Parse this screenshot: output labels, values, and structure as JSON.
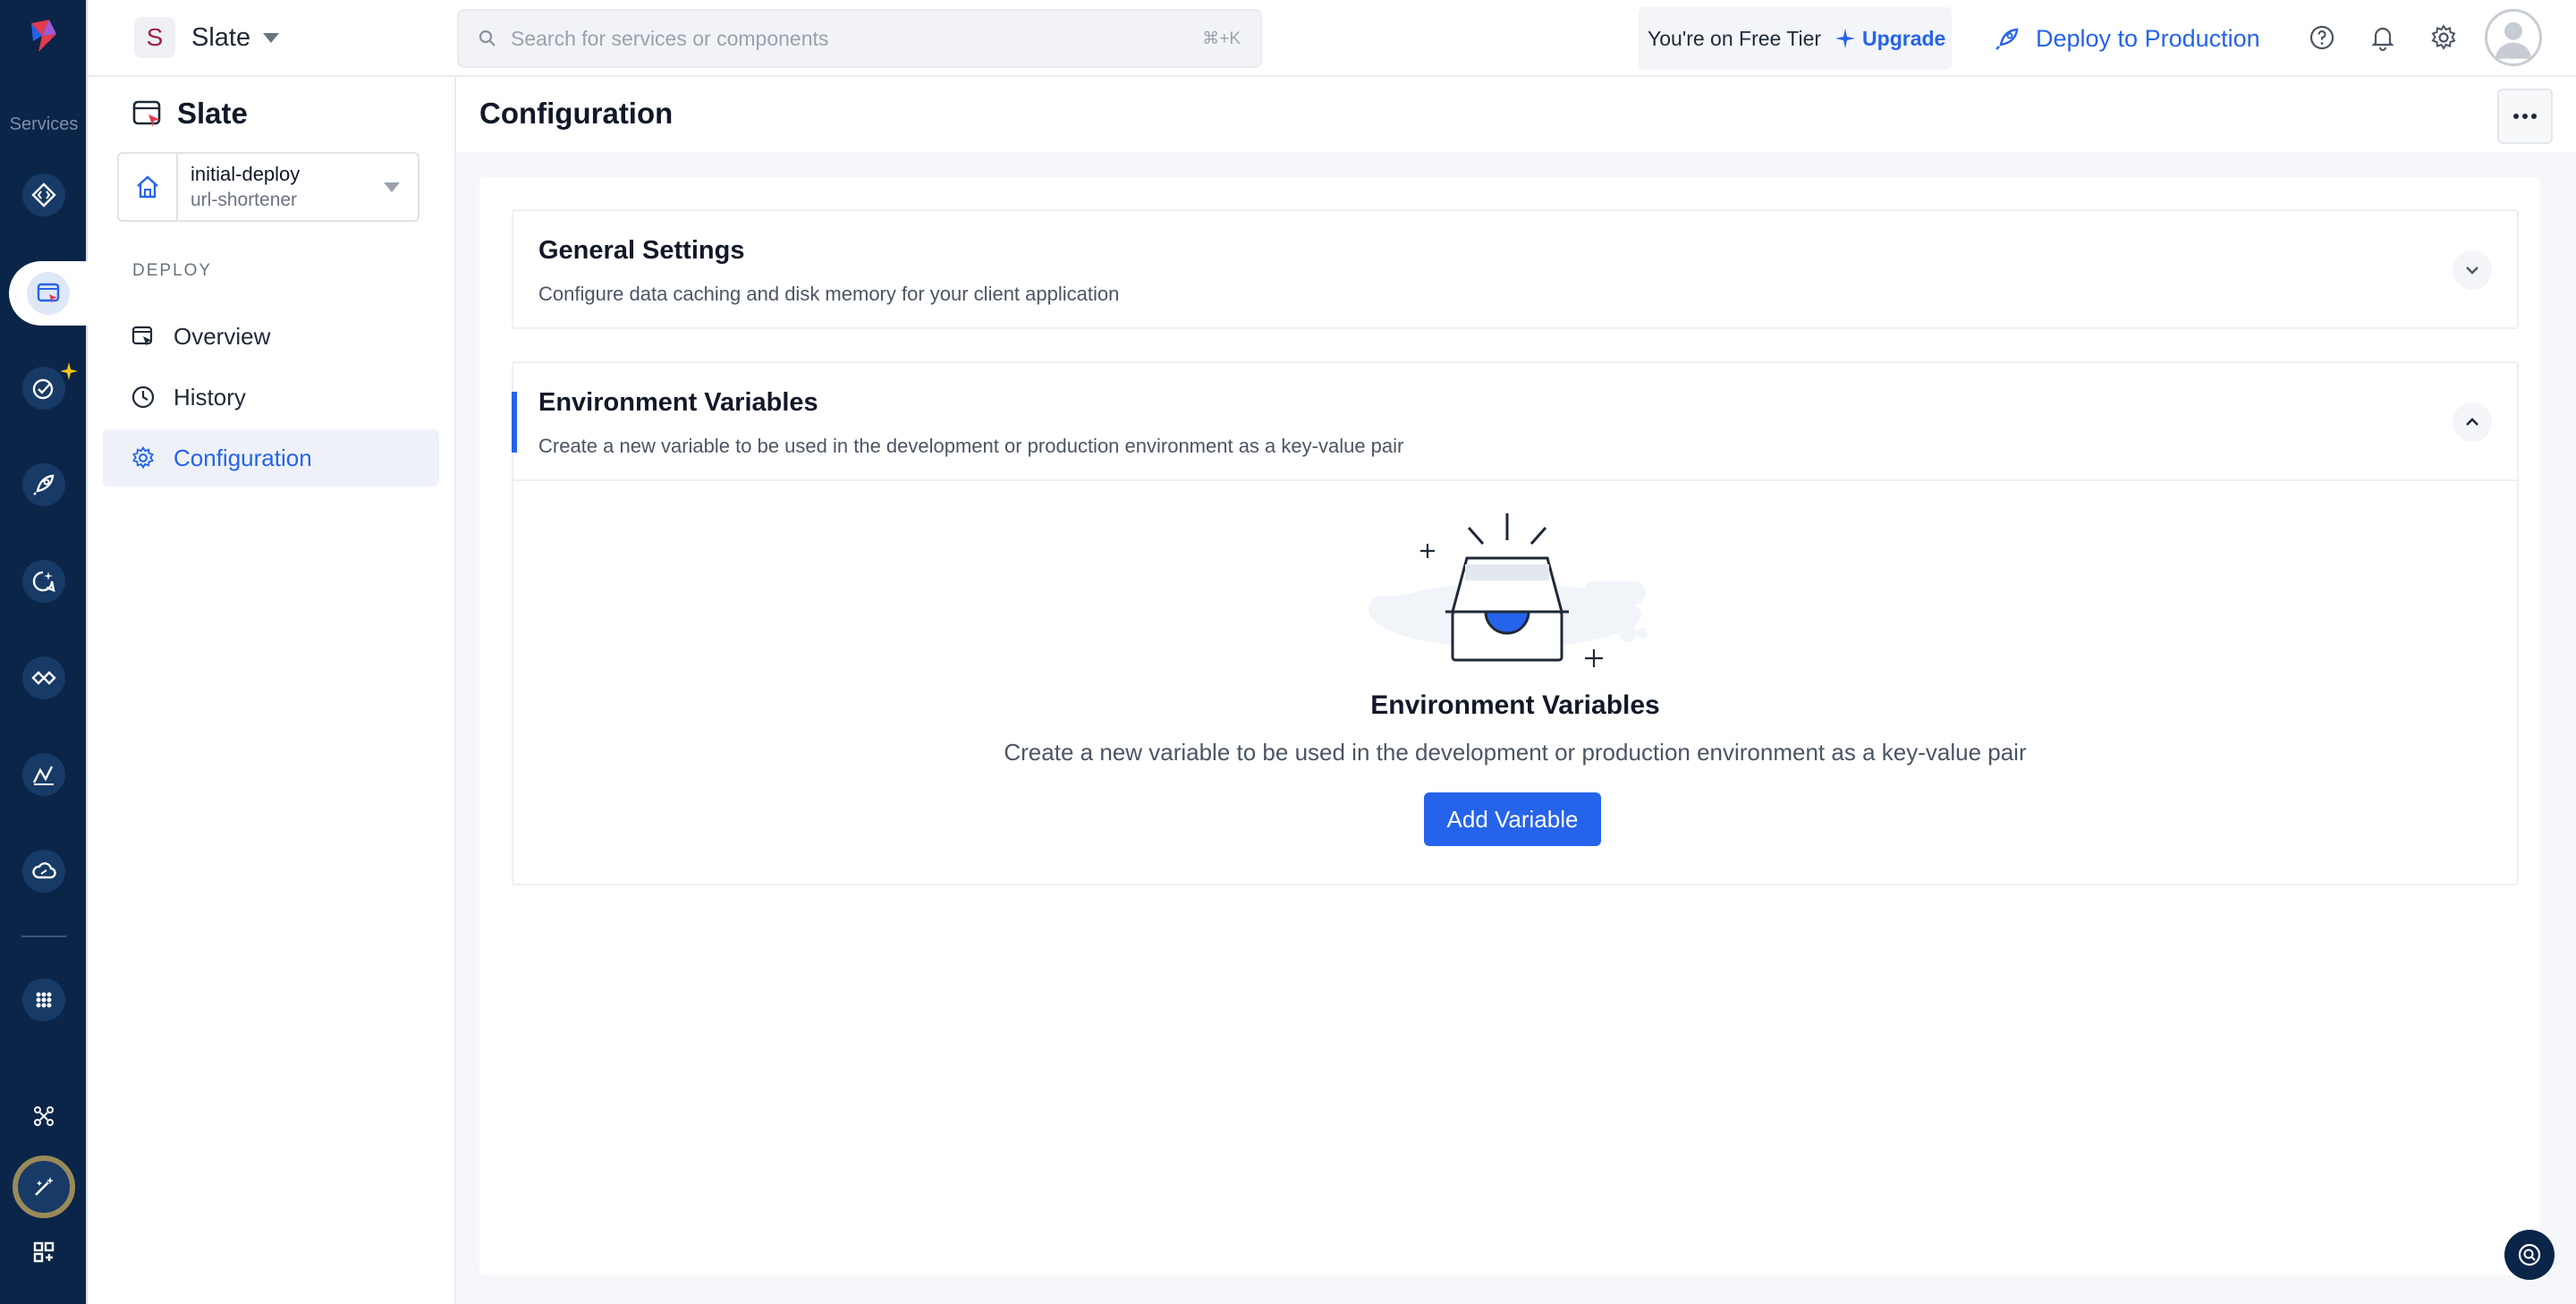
{
  "rail": {
    "label": "Services",
    "items": [
      {
        "icon": "code-diamond-icon"
      },
      {
        "icon": "slate-window-icon",
        "active": true
      },
      {
        "icon": "target-sparkle-icon"
      },
      {
        "icon": "rocket-icon"
      },
      {
        "icon": "chat-sparkle-icon"
      },
      {
        "icon": "handshake-icon"
      },
      {
        "icon": "chart-pen-icon"
      },
      {
        "icon": "cloud-icon"
      },
      {
        "icon": "apps-grid-icon"
      },
      {
        "icon": "network-icon"
      },
      {
        "icon": "magic-wand-icon"
      },
      {
        "icon": "add-apps-icon"
      }
    ]
  },
  "topbar": {
    "workspace_initial": "S",
    "workspace_name": "Slate",
    "search_placeholder": "Search for services or components",
    "search_shortcut": "⌘+K",
    "tier_text": "You're on Free Tier",
    "upgrade_label": "Upgrade",
    "deploy_label": "Deploy to Production"
  },
  "sidebar": {
    "title": "Slate",
    "branch": {
      "name": "initial-deploy",
      "project": "url-shortener"
    },
    "section": "DEPLOY",
    "items": [
      {
        "label": "Overview"
      },
      {
        "label": "History"
      },
      {
        "label": "Configuration",
        "active": true
      }
    ]
  },
  "main": {
    "title": "Configuration",
    "general": {
      "title": "General Settings",
      "description": "Configure data caching and disk memory for your client application"
    },
    "env": {
      "title": "Environment Variables",
      "description": "Create a new variable to be used in the development or production environment as a key-value pair",
      "empty_title": "Environment Variables",
      "empty_description": "Create a new variable to be used in the development or production environment as a key-value pair",
      "add_label": "Add Variable"
    }
  },
  "colors": {
    "accent": "#2563eb",
    "rail_bg": "#0b2548",
    "highlight": "#f5c518"
  }
}
